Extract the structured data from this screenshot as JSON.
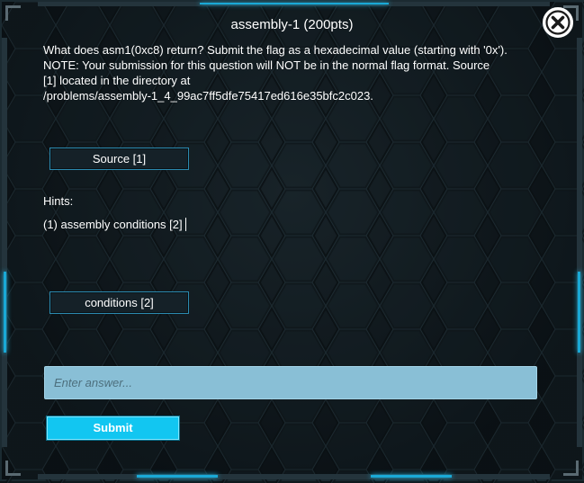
{
  "dialog": {
    "title": "assembly-1 (200pts)",
    "description_lines": [
      "What does asm1(0xc8) return? Submit the flag as a hexadecimal value (starting with '0x').",
      "NOTE: Your submission for this question will NOT be in the normal flag format. Source",
      "[1]  located in the directory at",
      "/problems/assembly-1_4_99ac7ff5dfe75417ed616e35bfc2c023."
    ],
    "source_button": "Source [1]",
    "hints_label": "Hints:",
    "hints": [
      "(1) assembly conditions [2]"
    ],
    "conditions_button": "conditions [2]",
    "answer": {
      "placeholder": "Enter answer...",
      "value": ""
    },
    "submit_label": "Submit",
    "close_icon": "close-circle-icon"
  },
  "theme": {
    "accent": "#12c6f1",
    "input_bg": "#89bfd6",
    "frame_glow": "#1aa9d6"
  }
}
